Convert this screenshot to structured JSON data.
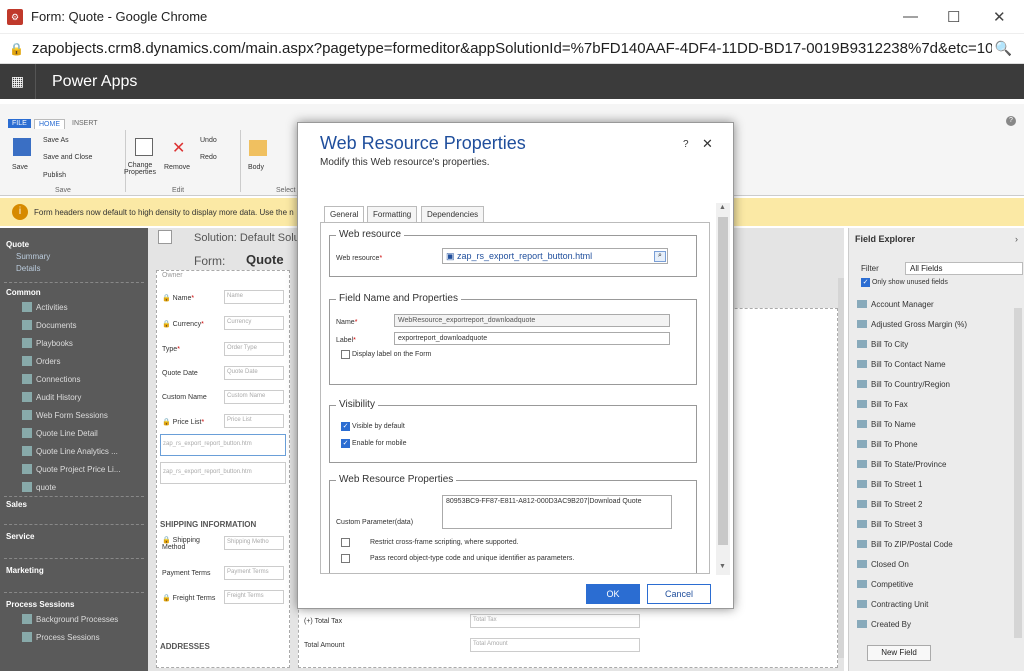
{
  "window": {
    "title": "Form: Quote - Google Chrome",
    "minimize": "—",
    "maximize": "☐",
    "close": "✕"
  },
  "browser": {
    "url": "zapobjects.crm8.dynamics.com/main.aspx?pagetype=formeditor&appSolutionId=%7bFD140AAF-4DF4-11DD-BD17-0019B9312238%7d&etc=1084&extr...",
    "zoom_icon": "zoom-icon"
  },
  "app": {
    "name": "Power Apps"
  },
  "ribbon": {
    "tabs": [
      "FILE",
      "HOME",
      "INSERT"
    ],
    "save": {
      "save": "Save",
      "save_as": "Save As",
      "save_close": "Save and Close",
      "publish": "Publish",
      "group": "Save"
    },
    "edit": {
      "change_props": "Change Properties",
      "remove": "Remove",
      "undo": "Undo",
      "redo": "Redo",
      "group": "Edit"
    },
    "select": {
      "body": "Body",
      "group": "Select"
    }
  },
  "notification": "Form headers now default to high density to display more data. Use the n",
  "left_nav": {
    "quote": {
      "header": "Quote",
      "items": [
        "Summary",
        "Details"
      ]
    },
    "common": {
      "header": "Common",
      "items": [
        "Activities",
        "Documents",
        "Playbooks",
        "Orders",
        "Connections",
        "Audit History",
        "Web Form Sessions",
        "Quote Line Detail",
        "Quote Line Analytics ...",
        "Quote Project Price Li...",
        "quote"
      ]
    },
    "sections": [
      "Sales",
      "Service",
      "Marketing"
    ],
    "process": {
      "header": "Process Sessions",
      "items": [
        "Background Processes",
        "Process Sessions"
      ]
    }
  },
  "form": {
    "solution_label": "Solution: Default Solu",
    "form_label": "Form:",
    "form_name": "Quote",
    "owner": "Owner",
    "fields": [
      {
        "label": "Name",
        "placeholder": "Name",
        "required": true
      },
      {
        "label": "Currency",
        "placeholder": "Currency",
        "required": true
      },
      {
        "label": "Type",
        "placeholder": "Order Type",
        "required": true
      },
      {
        "label": "Quote Date",
        "placeholder": "Quote Date",
        "required": false
      },
      {
        "label": "Custom Name",
        "placeholder": "Custom Name",
        "required": false
      },
      {
        "label": "Price List",
        "placeholder": "Price List",
        "required": true
      }
    ],
    "webres_1": "zap_rs_export_report_button.htm",
    "webres_2": "zap_rs_export_report_button.htm",
    "shipping_header": "SHIPPING INFORMATION",
    "shipping_fields": [
      {
        "label": "Shipping Method",
        "placeholder": "Shipping Metho"
      },
      {
        "label": "Payment Terms",
        "placeholder": "Payment Terms"
      },
      {
        "label": "Freight Terms",
        "placeholder": "Freight Terms"
      }
    ],
    "addresses_header": "ADDRESSES",
    "total_tax": "(+) Total Tax",
    "total_tax_ph": "Total Tax",
    "total_amount": "Total Amount",
    "total_amount_ph": "Total Amount"
  },
  "explorer": {
    "title": "Field Explorer",
    "filter_label": "Filter",
    "filter_value": "All Fields",
    "only_unused": "Only show unused fields",
    "fields": [
      "Account Manager",
      "Adjusted Gross Margin (%)",
      "Bill To City",
      "Bill To Contact Name",
      "Bill To Country/Region",
      "Bill To Fax",
      "Bill To Name",
      "Bill To Phone",
      "Bill To State/Province",
      "Bill To Street 1",
      "Bill To Street 2",
      "Bill To Street 3",
      "Bill To ZIP/Postal Code",
      "Closed On",
      "Competitive",
      "Contracting Unit",
      "Created By"
    ],
    "new_field": "New Field"
  },
  "dialog": {
    "title": "Web Resource Properties",
    "subtitle": "Modify this Web resource's properties.",
    "help": "?",
    "close": "✕",
    "tabs": [
      "General",
      "Formatting",
      "Dependencies"
    ],
    "web_resource": {
      "legend": "Web resource",
      "label": "Web resource",
      "value": "zap_rs_export_report_button.html"
    },
    "field_name": {
      "legend": "Field Name and Properties",
      "name_label": "Name",
      "name_value": "WebResource_exportreport_downloadquote",
      "label_label": "Label",
      "label_value": "exportreport_downloadquote",
      "display_label": "Display label on the Form"
    },
    "visibility": {
      "legend": "Visibility",
      "visible": "Visible by default",
      "mobile": "Enable for mobile"
    },
    "props": {
      "legend": "Web Resource Properties",
      "custom_label": "Custom Parameter(data)",
      "custom_value": "80953BC9-FF87-E811-A812-000D3AC9B207|Download Quote",
      "restrict": "Restrict cross-frame scripting, where supported.",
      "pass": "Pass record object-type code and unique identifier as parameters."
    },
    "ok": "OK",
    "cancel": "Cancel"
  }
}
